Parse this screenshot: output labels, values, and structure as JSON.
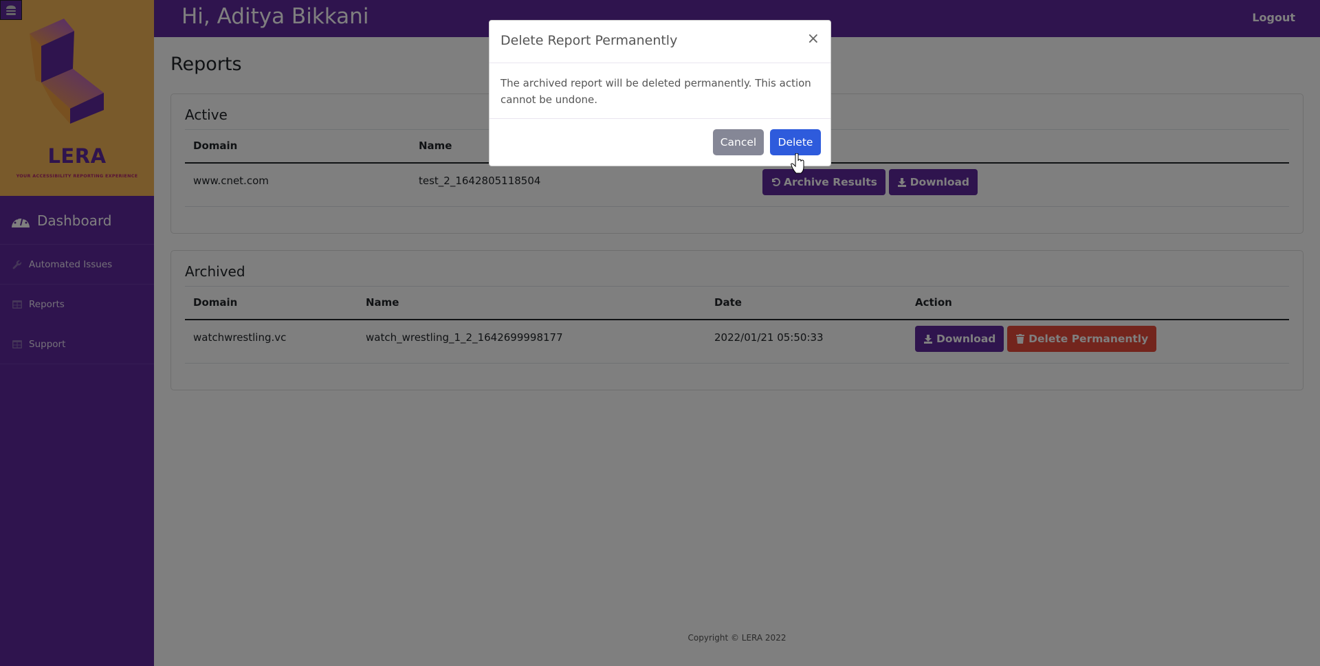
{
  "sidebar": {
    "menu_icon": "hamburger-icon",
    "logo": {
      "title": "LERA",
      "tagline": "YOUR ACCESSIBILITY REPORTING EXPERIENCE"
    },
    "dashboard": {
      "label": "Dashboard",
      "icon": "tachometer-icon"
    },
    "items": [
      {
        "label": "Automated Issues",
        "icon": "wrench-icon"
      },
      {
        "label": "Reports",
        "icon": "table-icon"
      },
      {
        "label": "Support",
        "icon": "table-icon"
      }
    ]
  },
  "header": {
    "greeting": "Hi, Aditya Bikkani",
    "logout_label": "Logout"
  },
  "main": {
    "page_title": "Reports",
    "active": {
      "title": "Active",
      "columns": [
        "Domain",
        "Name"
      ],
      "rows": [
        {
          "domain": "www.cnet.com",
          "name": "test_2_1642805118504",
          "actions": [
            {
              "label": "Archive Results",
              "icon": "undo-icon"
            },
            {
              "label": "Download",
              "icon": "download-icon"
            }
          ]
        }
      ]
    },
    "archived": {
      "title": "Archived",
      "columns": [
        "Domain",
        "Name",
        "Date",
        "Action"
      ],
      "rows": [
        {
          "domain": "watchwrestling.vc",
          "name": "watch_wrestling_1_2_1642699998177",
          "date": "2022/01/21 05:50:33",
          "actions": [
            {
              "label": "Download",
              "icon": "download-icon"
            },
            {
              "label": "Delete Permanently",
              "icon": "trash-icon"
            }
          ]
        }
      ]
    }
  },
  "footer": {
    "copyright": "Copyright © LERA 2022"
  },
  "modal": {
    "title": "Delete Report Permanently",
    "close_label": "×",
    "body": "The archived report will be deleted permanently. This action cannot be undone.",
    "cancel_label": "Cancel",
    "delete_label": "Delete"
  },
  "colors": {
    "brand_purple": "#5f289d",
    "logo_gold": "#f3b557",
    "danger": "#e74a3b",
    "primary": "#2e5bdc",
    "secondary": "#858796"
  }
}
